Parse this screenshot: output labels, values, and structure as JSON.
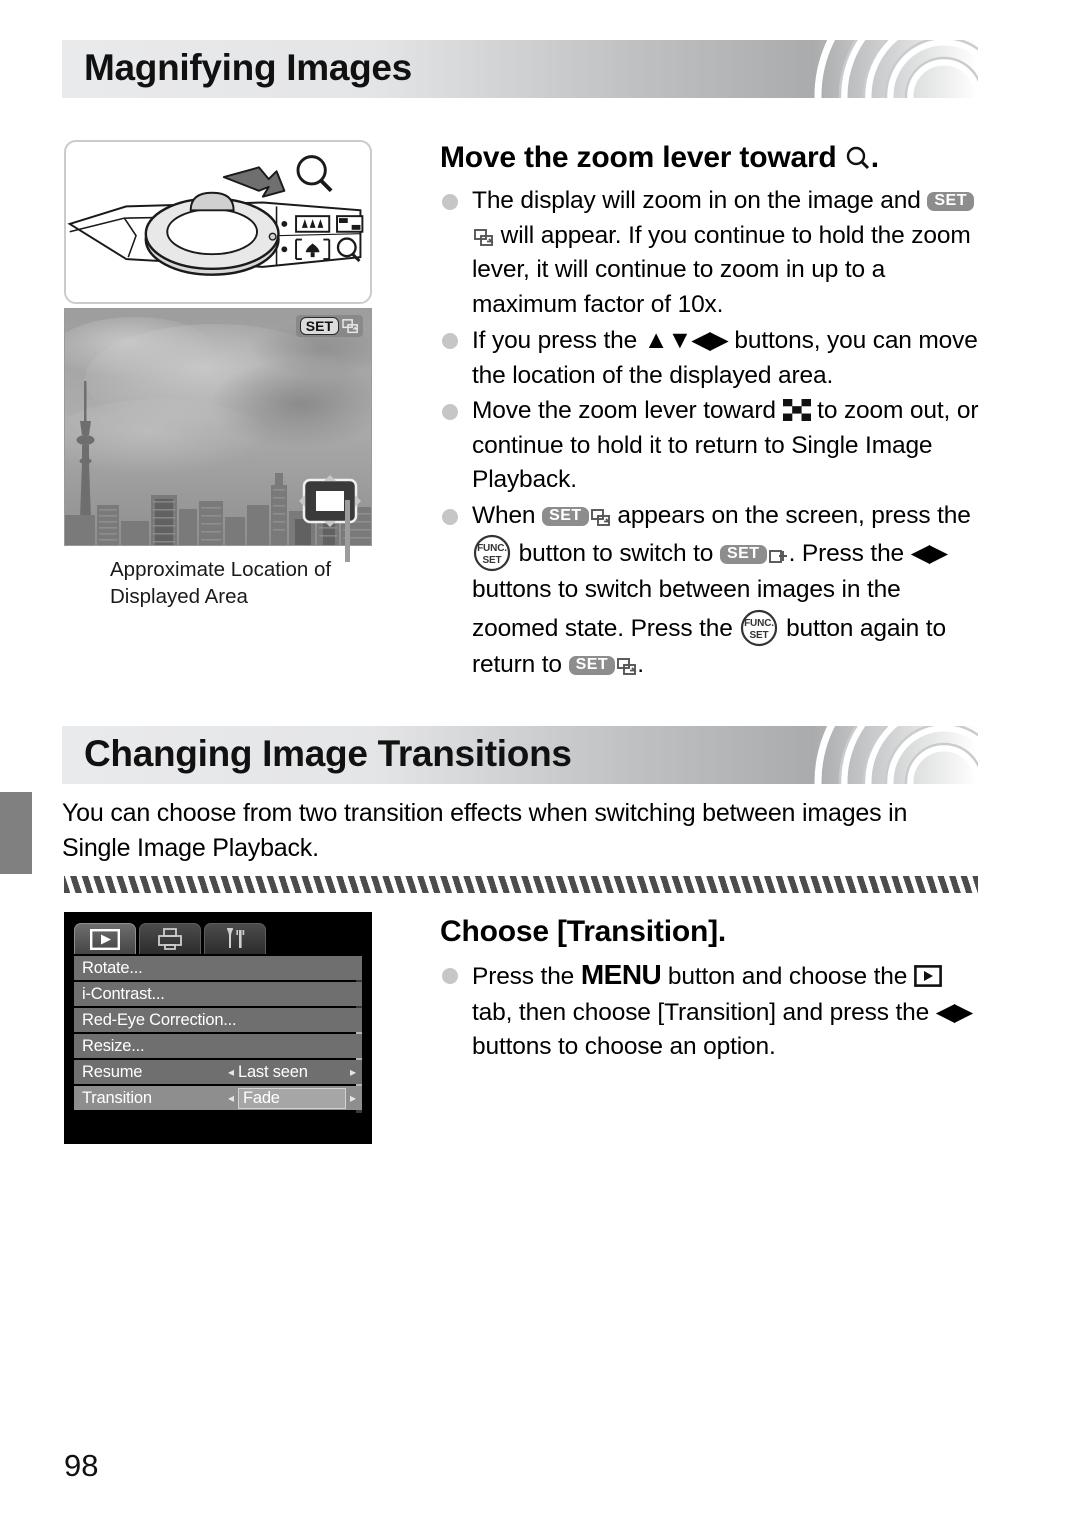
{
  "page": {
    "number": "98",
    "chapter_tab": ""
  },
  "sections": [
    {
      "title": "Magnifying Images",
      "step_title_pre": "Move the zoom lever toward ",
      "step_title_post": ".",
      "figures": {
        "zoom_lever": {
          "name": "zoom-lever-illustration",
          "magnifier_label": "magnifier-icon",
          "arrow_label": "arrow-right-icon",
          "wide_label": "wide-angle-icon",
          "tele_label": "telephoto-icon",
          "index_label": "index-icon"
        },
        "photo": {
          "name": "zoomed-photo-screenshot",
          "badge_set": "SET",
          "caption_line1": "Approximate Location of",
          "caption_line2": "Displayed Area"
        }
      },
      "bullets": [
        {
          "parts": [
            {
              "t": "text",
              "v": "The display will zoom in on the image and "
            },
            {
              "t": "icon",
              "v": "set-badge"
            },
            {
              "t": "icon",
              "v": "swap-icon"
            },
            {
              "t": "text",
              "v": " will appear. If you continue to hold the zoom lever, it will continue to zoom in up to a maximum factor of 10x."
            }
          ]
        },
        {
          "parts": [
            {
              "t": "text",
              "v": "If you press the "
            },
            {
              "t": "icon",
              "v": "updown-leftright-arrows"
            },
            {
              "t": "text",
              "v": " buttons, you can move the location of the displayed area."
            }
          ]
        },
        {
          "parts": [
            {
              "t": "text",
              "v": "Move the zoom lever toward "
            },
            {
              "t": "icon",
              "v": "index-checkerboard-icon"
            },
            {
              "t": "text",
              "v": " to zoom out, or continue to hold it to return to Single Image Playback."
            }
          ]
        },
        {
          "parts": [
            {
              "t": "text",
              "v": "When "
            },
            {
              "t": "icon",
              "v": "set-badge"
            },
            {
              "t": "icon",
              "v": "swap-icon"
            },
            {
              "t": "text",
              "v": " appears on the screen, press the "
            },
            {
              "t": "icon",
              "v": "func-set-button"
            },
            {
              "t": "text",
              "v": " button to switch to "
            },
            {
              "t": "icon",
              "v": "set-badge"
            },
            {
              "t": "icon",
              "v": "jump-icon"
            },
            {
              "t": "text",
              "v": ". Press the "
            },
            {
              "t": "icon",
              "v": "leftright-arrows"
            },
            {
              "t": "text",
              "v": " buttons to switch between images in the zoomed state. Press the "
            },
            {
              "t": "icon",
              "v": "func-set-button"
            },
            {
              "t": "text",
              "v": " button again to return to "
            },
            {
              "t": "icon",
              "v": "set-badge"
            },
            {
              "t": "icon",
              "v": "swap-icon"
            },
            {
              "t": "text",
              "v": "."
            }
          ]
        }
      ]
    },
    {
      "title": "Changing Image Transitions",
      "intro": "You can choose from two transition effects when switching between images in Single Image Playback.",
      "step_title": "Choose [Transition].",
      "bullets": [
        {
          "parts": [
            {
              "t": "text",
              "v": "Press the "
            },
            {
              "t": "menuword",
              "v": "MENU"
            },
            {
              "t": "text",
              "v": " button and choose the "
            },
            {
              "t": "icon",
              "v": "playback-tab-icon"
            },
            {
              "t": "text",
              "v": " tab, then choose [Transition] and press the "
            },
            {
              "t": "icon",
              "v": "leftright-arrows"
            },
            {
              "t": "text",
              "v": " buttons to choose an option."
            }
          ]
        }
      ],
      "camera_menu": {
        "tabs": [
          {
            "icon": "playback-tab-icon",
            "active": true
          },
          {
            "icon": "print-tab-icon",
            "active": false
          },
          {
            "icon": "settings-tab-icon",
            "active": false
          }
        ],
        "rows": [
          {
            "label": "Rotate...",
            "value": "",
            "selected": false,
            "has_arrows": false
          },
          {
            "label": "i-Contrast...",
            "value": "",
            "selected": false,
            "has_arrows": false
          },
          {
            "label": "Red-Eye Correction...",
            "value": "",
            "selected": false,
            "has_arrows": false
          },
          {
            "label": "Resize...",
            "value": "",
            "selected": false,
            "has_arrows": false
          },
          {
            "label": "Resume",
            "value": "Last seen",
            "selected": false,
            "has_arrows": true
          },
          {
            "label": "Transition",
            "value": "Fade",
            "selected": true,
            "has_arrows": true
          }
        ],
        "arrow_left": "◂",
        "arrow_right": "▸"
      }
    }
  ],
  "colors": {
    "header_light": "#e9eaec",
    "header_dark": "#a9abad",
    "bullet_dot": "#c6c6c6",
    "set_badge_bg": "#8d8d8d",
    "menu_row_bg": "#6f6f6f",
    "menu_row_selected": "#8e8e8e",
    "chapter_tab": "#808080"
  }
}
